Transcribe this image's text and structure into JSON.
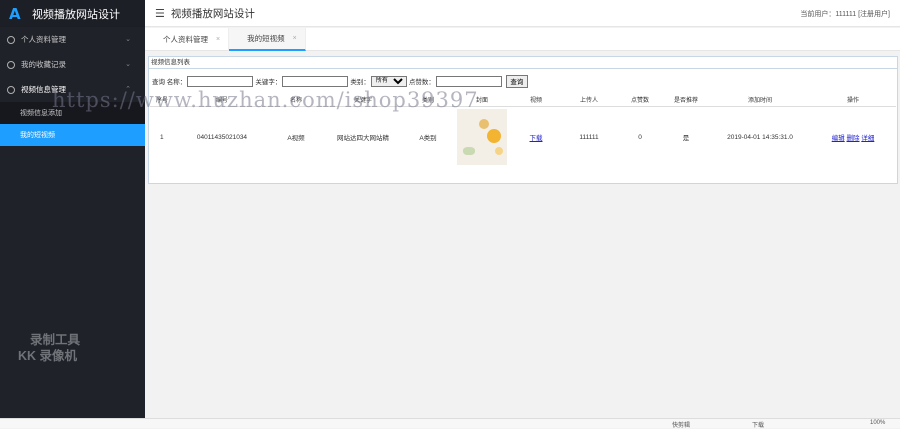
{
  "app": {
    "title": "视频播放网站设计",
    "logo_letter": "A"
  },
  "sidebar": {
    "items": [
      {
        "label": "个人资料管理",
        "icon": "circle-icon"
      },
      {
        "label": "我的收藏记录",
        "icon": "circle-icon"
      },
      {
        "label": "视频信息管理",
        "icon": "circle-icon"
      }
    ],
    "subitems": [
      {
        "label": "视频信息添加"
      },
      {
        "label": "我的短视频"
      }
    ]
  },
  "topbar": {
    "title": "视频播放网站设计",
    "user": "当前用户：111111 [注册用户]"
  },
  "tabs": [
    {
      "label": "个人资料管理"
    },
    {
      "label": "我的短视频"
    }
  ],
  "panel": {
    "heading": "视频信息列表",
    "search": {
      "label_name": "查询 名称：",
      "label_keyword": "关键字：",
      "label_category": "类别：",
      "category_selected": "所有",
      "label_clicks": "点赞数：",
      "button": "查询"
    },
    "columns": [
      "序号",
      "编号",
      "名称",
      "关键字",
      "类别",
      "封面",
      "视频",
      "上传人",
      "点赞数",
      "是否推荐",
      "添加时间",
      "操作"
    ],
    "rows": [
      {
        "index": "1",
        "code": "04011435021034",
        "name": "A视频",
        "keyword": "网站达四大网站精",
        "category": "A类别",
        "video": "下载",
        "uploader": "111111",
        "likes": "0",
        "recommended": "是",
        "time": "2019-04-01 14:35:31.0",
        "actions": [
          "编辑",
          "删除",
          "详细"
        ]
      }
    ]
  },
  "watermark": "https://www.huzhan.com/ishop39397",
  "recorder": {
    "line1": "录制工具",
    "line2": "KK 录像机"
  },
  "statusbar": [
    "快剪辑",
    "下载",
    "100%"
  ],
  "colors": {
    "sidebar": "#20222a",
    "accent": "#1e9fff",
    "panel_border": "#c7d7e6"
  }
}
